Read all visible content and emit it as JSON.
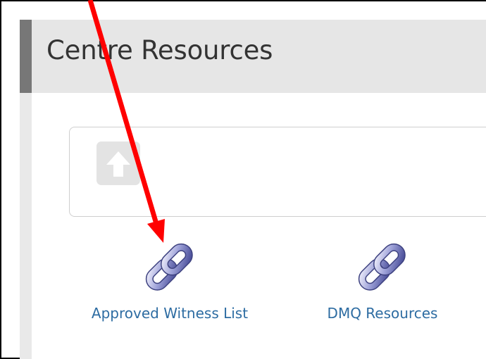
{
  "panel": {
    "title": "Centre Resources"
  },
  "navigation": {
    "up_icon": "up-arrow-icon"
  },
  "resources": [
    {
      "label": "Approved Witness List",
      "icon": "chain-link-icon"
    },
    {
      "label": "DMQ Resources",
      "icon": "chain-link-icon"
    }
  ],
  "colors": {
    "header_bg": "#e6e6e6",
    "accent_bar": "#777777",
    "link_text": "#2d6ca2",
    "annotation": "#ff0000"
  }
}
